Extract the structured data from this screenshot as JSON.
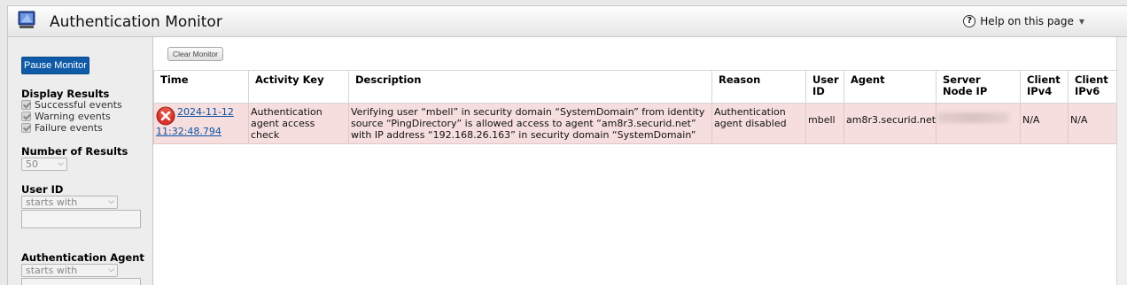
{
  "header": {
    "title": "Authentication Monitor",
    "help_label": "Help on this page"
  },
  "sidebar": {
    "pause_label": "Pause Monitor",
    "display_results_label": "Display Results",
    "display_options": [
      "Successful events",
      "Warning events",
      "Failure events"
    ],
    "number_of_results_label": "Number of Results",
    "number_of_results_value": "50",
    "user_id_label": "User ID",
    "user_id_match": "starts with",
    "auth_agent_label": "Authentication Agent",
    "auth_agent_match": "starts with"
  },
  "toolbar": {
    "clear_label": "Clear Monitor"
  },
  "table": {
    "headers": [
      "Time",
      "Activity Key",
      "Description",
      "Reason",
      "User ID",
      "Agent",
      "Server Node IP",
      "Client IPv4",
      "Client IPv6"
    ],
    "rows": [
      {
        "time_date": "2024-11-12",
        "time_clock": "11:32:48.794",
        "activity_key": "Authentication agent access check",
        "description": "Verifying user “mbell” in security domain “SystemDomain” from identity source “PingDirectory” is allowed access to agent “am8r3.securid.net” with IP address “192.168.26.163” in security domain “SystemDomain”",
        "reason": "Authentication agent disabled",
        "user_id": "mbell",
        "agent": "am8r3.securid.net",
        "client_ipv4": "N/A",
        "client_ipv6": "N/A",
        "status_icon": "error-icon"
      }
    ]
  },
  "colors": {
    "error_row": "#f6dede",
    "accent": "#0f5ba8",
    "link": "#0b54a5"
  }
}
